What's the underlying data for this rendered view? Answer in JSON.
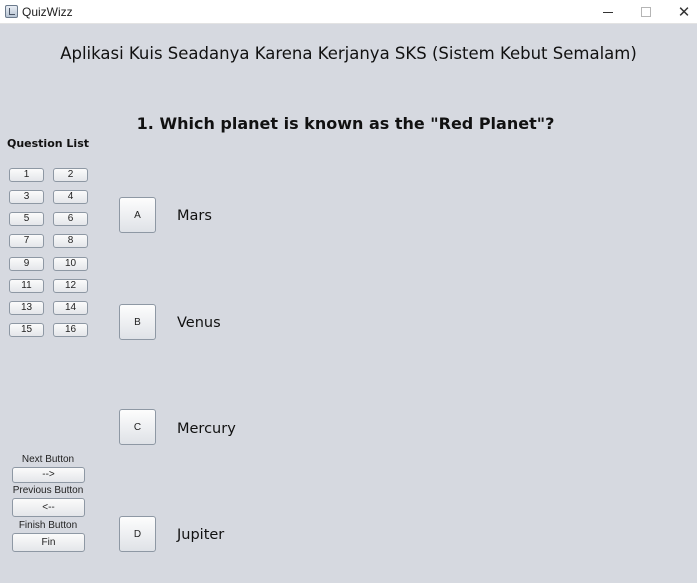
{
  "window": {
    "title": "QuizWizz"
  },
  "app": {
    "heading": "Aplikasi Kuis Seadanya Karena Kerjanya SKS (Sistem Kebut Semalam)"
  },
  "question": {
    "text": "1. Which planet is known as the \"Red Planet\"?"
  },
  "question_list": {
    "label": "Question List",
    "buttons": [
      "1",
      "2",
      "3",
      "4",
      "5",
      "6",
      "7",
      "8",
      "9",
      "10",
      "11",
      "12",
      "13",
      "14",
      "15",
      "16"
    ]
  },
  "answers": [
    {
      "button": "A",
      "text": "Mars"
    },
    {
      "button": "B",
      "text": "Venus"
    },
    {
      "button": "C",
      "text": "Mercury"
    },
    {
      "button": "D",
      "text": "Jupiter"
    }
  ],
  "nav": {
    "next_label": "Next Button",
    "next_button": "-->",
    "previous_label": "Previous Button",
    "previous_button": "<--",
    "finish_label": "Finish Button",
    "finish_button": "Fin"
  }
}
